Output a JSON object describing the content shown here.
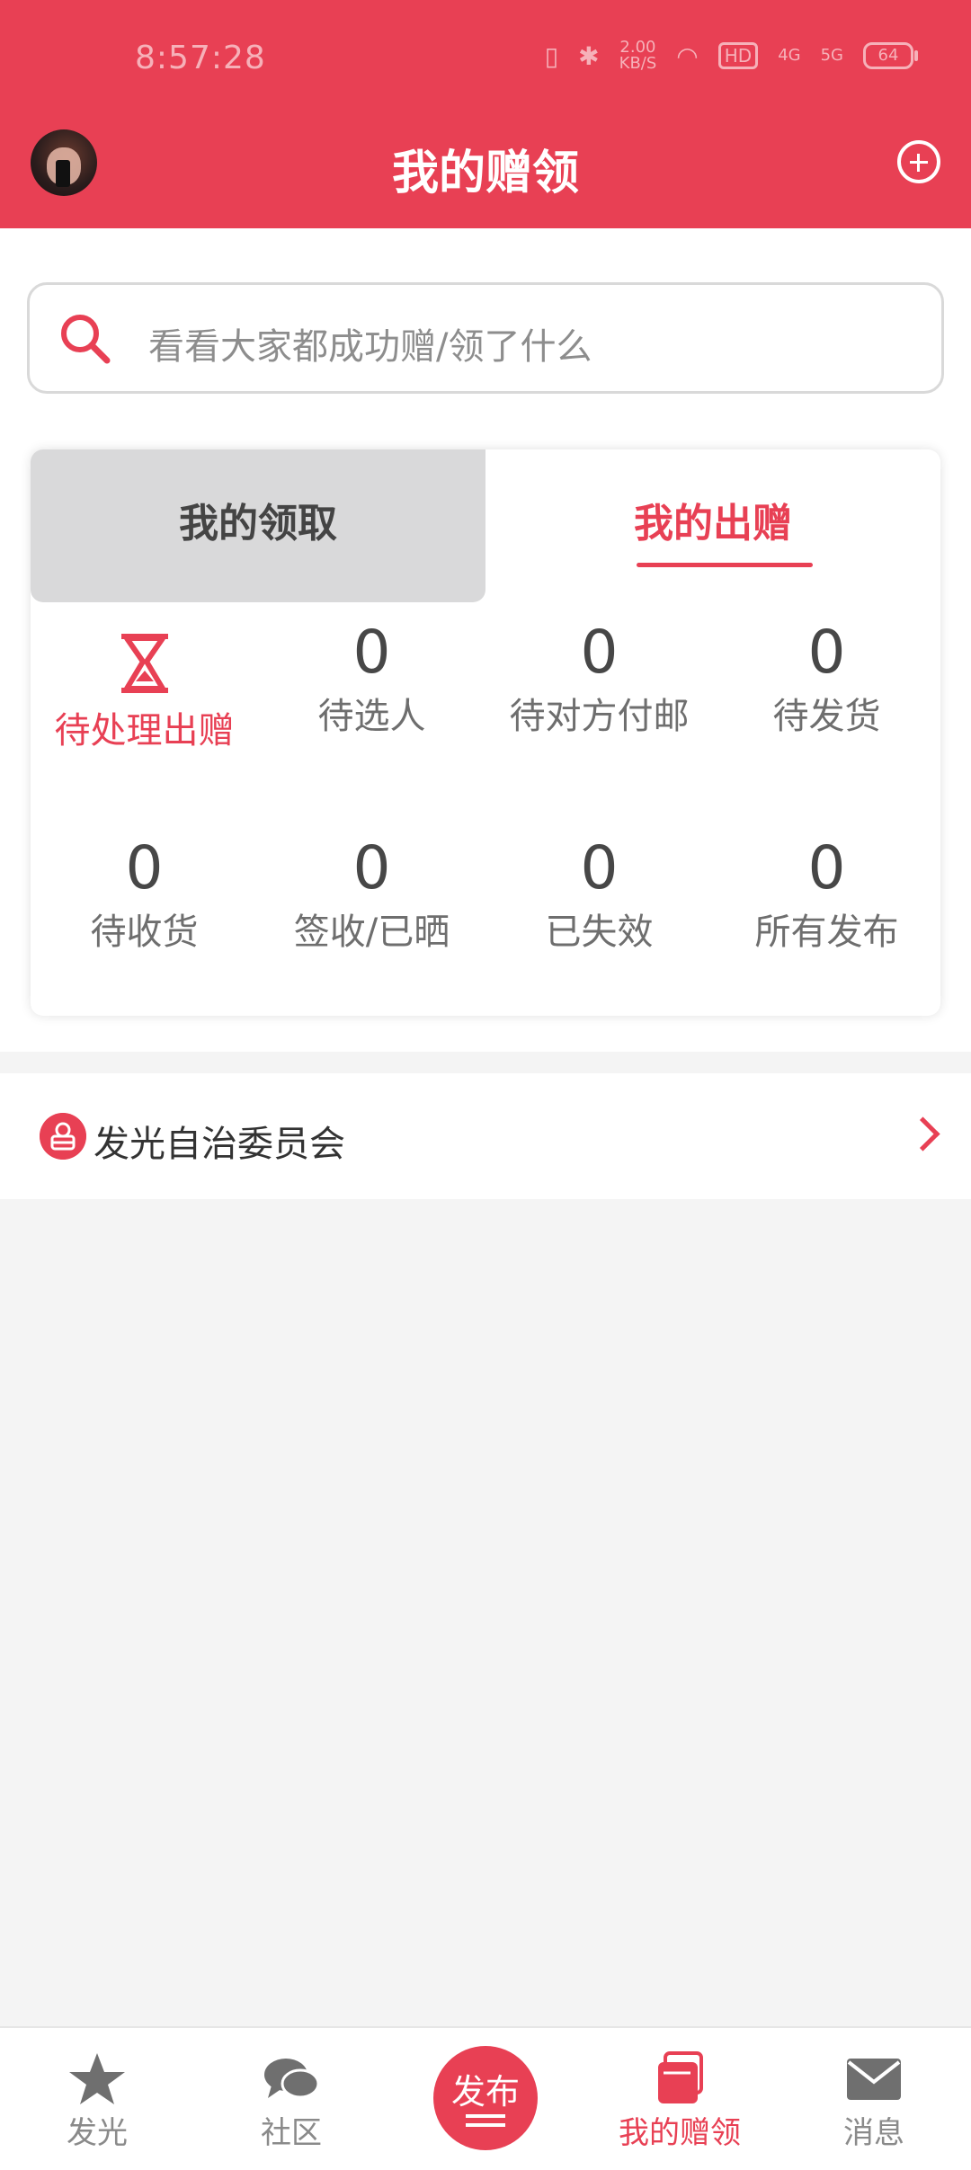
{
  "status_bar": {
    "time": "8:57:28",
    "network_speed": "2.00",
    "network_unit": "KB/S",
    "hd_label": "HD",
    "signal_4g": "4G",
    "signal_5g": "5G",
    "battery": "64"
  },
  "header": {
    "title": "我的赠领",
    "background_color": "#e84054"
  },
  "search": {
    "placeholder": "看看大家都成功赠/领了什么"
  },
  "tabs": {
    "left_label": "我的领取",
    "right_label": "我的出赠",
    "active": "我的出赠"
  },
  "stats_row1": [
    {
      "label": "待处理出赠",
      "icon": "hourglass-icon"
    },
    {
      "value": "0",
      "label": "待选人"
    },
    {
      "value": "0",
      "label": "待对方付邮"
    },
    {
      "value": "0",
      "label": "待发货"
    }
  ],
  "stats_row2": [
    {
      "value": "0",
      "label": "待收货"
    },
    {
      "value": "0",
      "label": "签收/已晒"
    },
    {
      "value": "0",
      "label": "已失效"
    },
    {
      "value": "0",
      "label": "所有发布"
    }
  ],
  "community": {
    "label": "发光自治委员会"
  },
  "bottom_nav": {
    "items": [
      {
        "label": "发光",
        "icon": "star-icon"
      },
      {
        "label": "社区",
        "icon": "chat-bubbles-icon"
      },
      {
        "label": "发布",
        "icon": "publish-button"
      },
      {
        "label": "我的赠领",
        "icon": "cards-icon",
        "active": true
      },
      {
        "label": "消息",
        "icon": "mail-icon"
      }
    ]
  }
}
